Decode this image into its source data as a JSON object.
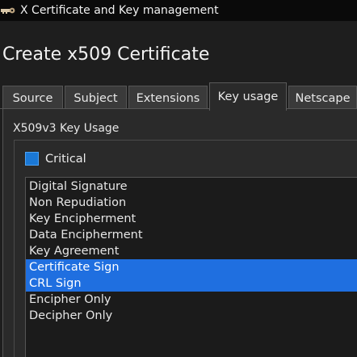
{
  "window": {
    "title": "X Certificate and Key management"
  },
  "page": {
    "title": "Create x509 Certificate"
  },
  "tabs": [
    {
      "label": "Source",
      "active": false
    },
    {
      "label": "Subject",
      "active": false
    },
    {
      "label": "Extensions",
      "active": false
    },
    {
      "label": "Key usage",
      "active": true
    },
    {
      "label": "Netscape",
      "active": false
    }
  ],
  "key_usage": {
    "group_title": "X509v3 Key Usage",
    "critical": {
      "label": "Critical",
      "checked": true
    },
    "items": [
      {
        "label": "Digital Signature",
        "selected": false
      },
      {
        "label": "Non Repudiation",
        "selected": false
      },
      {
        "label": "Key Encipherment",
        "selected": false
      },
      {
        "label": "Data Encipherment",
        "selected": false
      },
      {
        "label": "Key Agreement",
        "selected": false
      },
      {
        "label": "Certificate Sign",
        "selected": true
      },
      {
        "label": "CRL Sign",
        "selected": true
      },
      {
        "label": "Encipher Only",
        "selected": false
      },
      {
        "label": "Decipher Only",
        "selected": false
      }
    ]
  },
  "colors": {
    "selection": "#1f6fe0",
    "checkbox": "#1a78d6",
    "background": "#1e1e1e"
  },
  "icons": {
    "app": "app-icon"
  }
}
